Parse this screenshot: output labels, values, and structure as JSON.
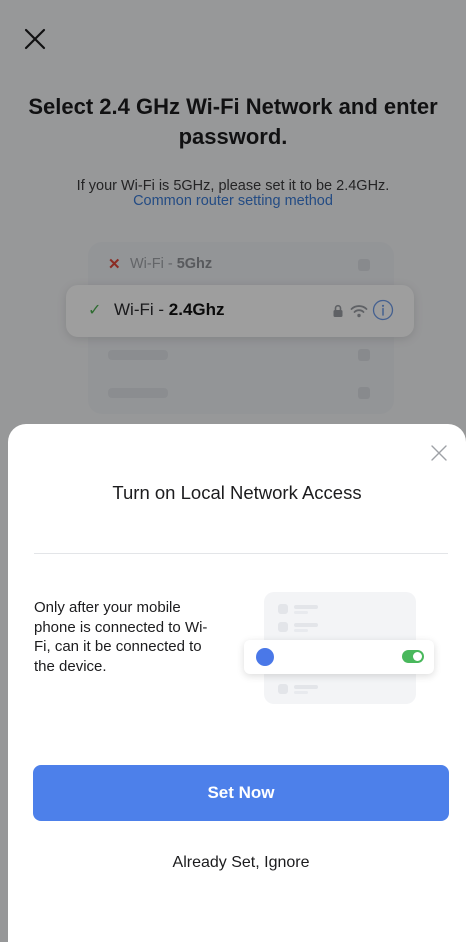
{
  "background": {
    "title": "Select 2.4 GHz Wi-Fi Network and enter password.",
    "subtitle": "If your Wi-Fi is 5GHz, please set it to be 2.4GHz.",
    "link": "Common router setting method",
    "networks": [
      {
        "prefix": "Wi-Fi - ",
        "band": "5Ghz",
        "status": "unsupported"
      },
      {
        "prefix": "Wi-Fi - ",
        "band": "2.4Ghz",
        "status": "supported"
      }
    ],
    "icons": {
      "close": "close-icon",
      "lock": "lock-icon",
      "wifi": "wifi-icon",
      "info": "info-icon"
    }
  },
  "sheet": {
    "title": "Turn on Local Network Access",
    "body": "Only after your mobile phone is connected to Wi-Fi, can it be connected to the device.",
    "primary_label": "Set Now",
    "secondary_label": "Already Set, Ignore"
  },
  "colors": {
    "accent": "#4d80ea",
    "link": "#3a7bd5",
    "success": "#4caf50",
    "error": "#e0473b",
    "toggle_on": "#49b85c"
  }
}
